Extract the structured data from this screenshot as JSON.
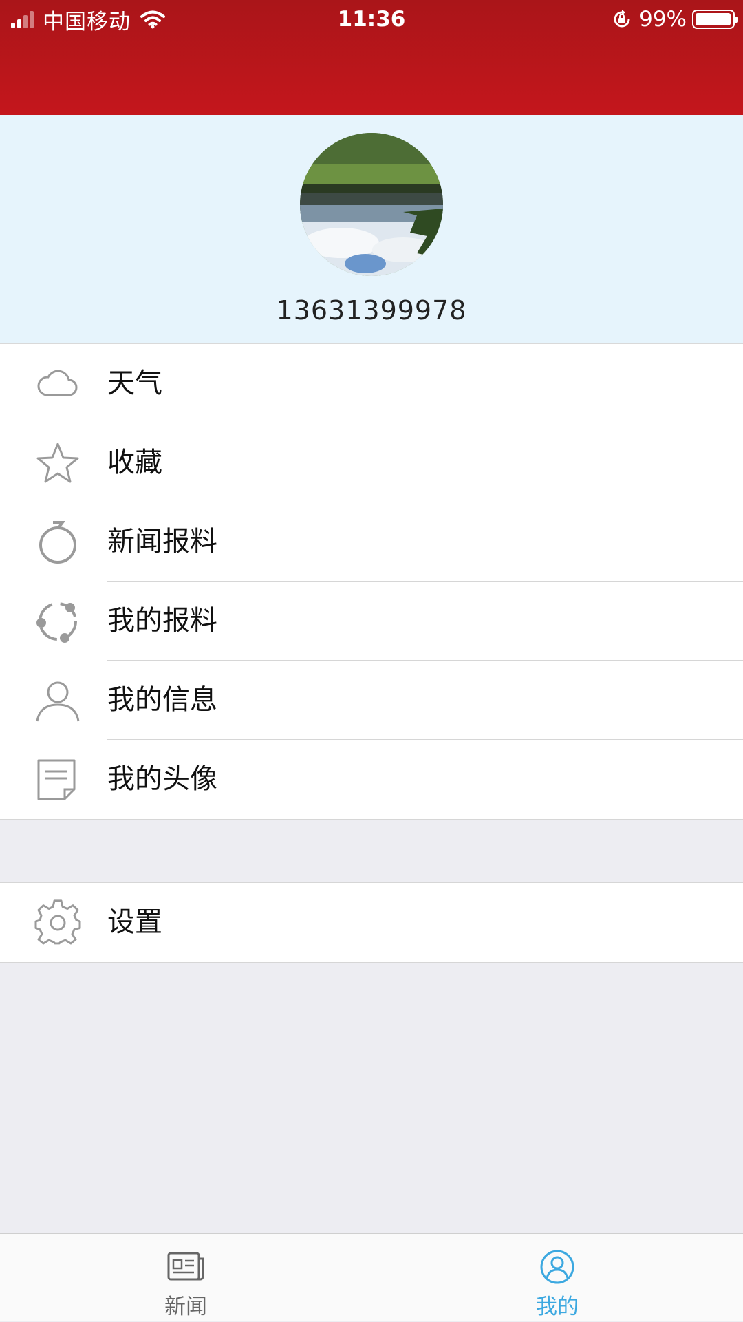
{
  "status_bar": {
    "carrier": "中国移动",
    "time": "11:36",
    "battery": "99%",
    "battery_level": 0.99,
    "icons": [
      "signal-icon",
      "wifi-icon",
      "rotation-lock-icon",
      "battery-icon"
    ]
  },
  "profile": {
    "phone": "13631399978",
    "avatar": "avatar-photo"
  },
  "menu": {
    "items": [
      {
        "label": "天气",
        "icon": "cloud-icon"
      },
      {
        "label": "收藏",
        "icon": "star-icon"
      },
      {
        "label": "新闻报料",
        "icon": "circle-tip-icon"
      },
      {
        "label": "我的报料",
        "icon": "share-circle-icon"
      },
      {
        "label": "我的信息",
        "icon": "user-icon"
      },
      {
        "label": "我的头像",
        "icon": "note-icon"
      }
    ]
  },
  "settings": {
    "label": "设置",
    "icon": "gear-icon"
  },
  "tabbar": {
    "tabs": [
      {
        "label": "新闻",
        "icon": "newspaper-icon",
        "active": false
      },
      {
        "label": "我的",
        "icon": "profile-icon",
        "active": true
      }
    ]
  },
  "colors": {
    "header_red": "#c4161c",
    "profile_bg": "#e6f4fc",
    "active_tab": "#3ca8e0",
    "inactive_tab": "#666666",
    "icon_gray": "#9a9a9a"
  }
}
